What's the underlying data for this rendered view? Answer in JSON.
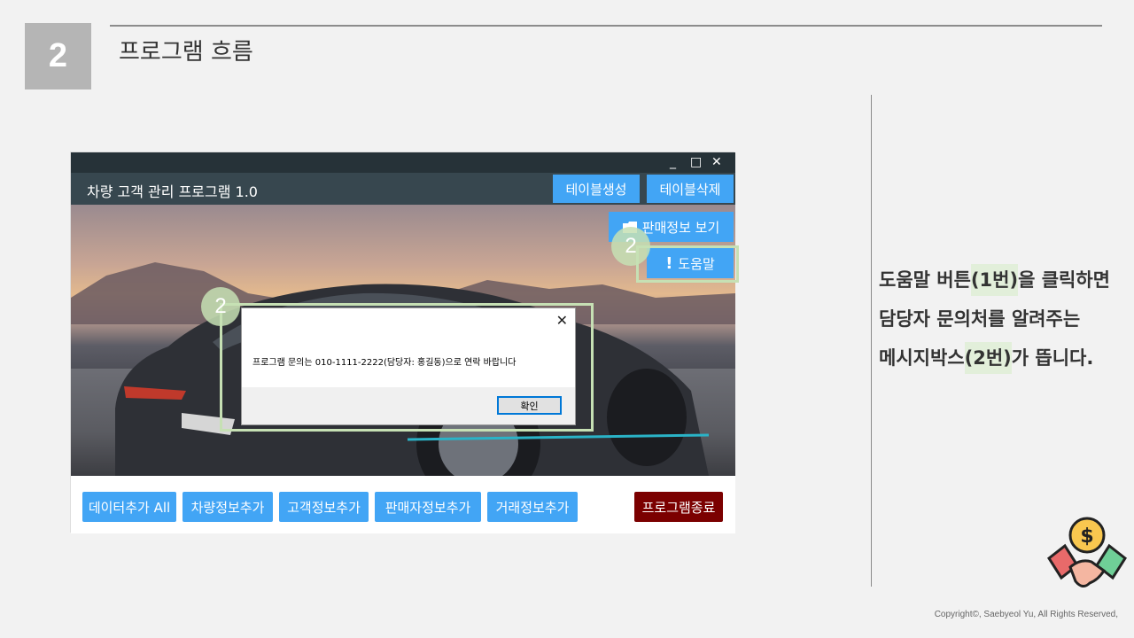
{
  "slide": {
    "number": "2",
    "title": "프로그램 흐름"
  },
  "app": {
    "window_controls": {
      "minimize": "_",
      "maximize": "□",
      "close": "✕"
    },
    "title": "차량 고객 관리 프로그램 1.0",
    "header_buttons": {
      "create_table": "테이블생성",
      "delete_table": "테이블삭제"
    },
    "side_buttons": {
      "view_sales": "판매정보 보기",
      "help": "도움말"
    },
    "bottom_buttons": {
      "add_all": "데이터추가 All",
      "add_vehicle": "차량정보추가",
      "add_customer": "고객정보추가",
      "add_seller": "판매자정보추가",
      "add_transaction": "거래정보추가",
      "exit": "프로그램종료"
    }
  },
  "messagebox": {
    "close": "✕",
    "text": "프로그램 문의는 010-1111-2222(담당자: 홍길동)으로 연락 바랍니다",
    "ok": "확인"
  },
  "badges": {
    "help_badge": "2",
    "msgbox_badge": "2"
  },
  "description": {
    "line1_a": "도움말 버튼",
    "line1_hl": "(1번)",
    "line1_b": "을 클릭하면",
    "line2": "담당자 문의처를 알려주는",
    "line3_a": "메시지박스",
    "line3_hl": "(2번)",
    "line3_b": "가 뜹니다."
  },
  "copyright": "Copyright©, Saebyeol Yu, All Rights Reserved,",
  "colors": {
    "button_blue": "#42a5f5",
    "exit_red": "#7b0000",
    "highlight_green": "#c6e0b4"
  }
}
